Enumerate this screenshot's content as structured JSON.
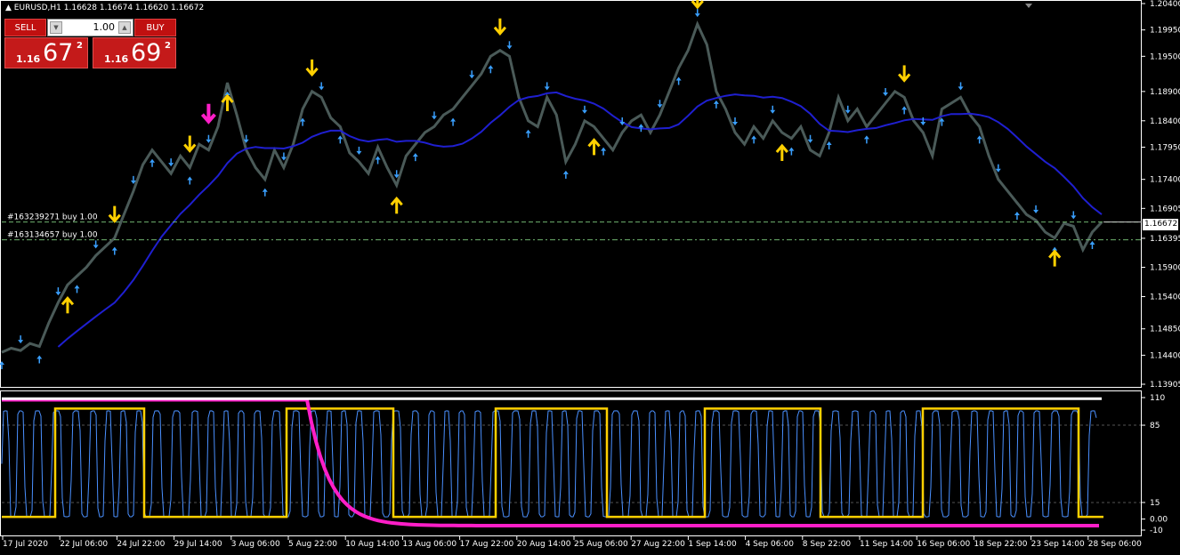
{
  "symbol_info": "EURUSD,H1  1.16628 1.16674 1.16620 1.16672",
  "trade_panel": {
    "sell_label": "SELL",
    "buy_label": "BUY",
    "lot": "1.00",
    "sell_prefix": "1.16",
    "sell_big": "67",
    "sell_sup": "2",
    "buy_prefix": "1.16",
    "buy_big": "69",
    "buy_sup": "2"
  },
  "current_price": "1.16672",
  "orders": [
    {
      "label": "#163239271 buy 1.00",
      "price": 1.16672
    },
    {
      "label": "#163134657 buy 1.00",
      "price": 1.1637
    }
  ],
  "colors": {
    "price_line": "#4a5a58",
    "ma": "#1f1fd0",
    "arrow_small": "#3aa0ff",
    "arrow_big": "#ffd000",
    "arrow_magenta": "#ff1ec8",
    "stoch_fast": "#4a90ff",
    "stoch_slow": "#ffd000",
    "order_line": "#6fb26f"
  },
  "chart_data": [
    {
      "type": "line",
      "y_ticks": [
        "1.20400",
        "1.19950",
        "1.19500",
        "1.18900",
        "1.18400",
        "1.17950",
        "1.17400",
        "1.16905",
        "1.16395",
        "1.15900",
        "1.15400",
        "1.14850",
        "1.14400",
        "1.13905"
      ],
      "ylim": [
        1.13905,
        1.204
      ],
      "x_ticks": [
        "17 Jul 2020",
        "22 Jul 06:00",
        "24 Jul 22:00",
        "29 Jul 14:00",
        "3 Aug 06:00",
        "5 Aug 22:00",
        "10 Aug 14:00",
        "13 Aug 06:00",
        "17 Aug 22:00",
        "20 Aug 14:00",
        "25 Aug 06:00",
        "27 Aug 22:00",
        "1 Sep 14:00",
        "4 Sep 06:00",
        "8 Sep 22:00",
        "11 Sep 14:00",
        "16 Sep 06:00",
        "18 Sep 22:00",
        "23 Sep 14:00",
        "28 Sep 06:00"
      ],
      "series": [
        {
          "values": [
            1.1445,
            1.1452,
            1.1448,
            1.146,
            1.1455,
            1.1495,
            1.153,
            1.156,
            1.1575,
            1.159,
            1.161,
            1.1625,
            1.164,
            1.168,
            1.172,
            1.1765,
            1.179,
            1.177,
            1.175,
            1.178,
            1.176,
            1.18,
            1.179,
            1.183,
            1.1905,
            1.185,
            1.179,
            1.176,
            1.174,
            1.179,
            1.176,
            1.18,
            1.186,
            1.189,
            1.188,
            1.1845,
            1.183,
            1.1785,
            1.177,
            1.175,
            1.1795,
            1.176,
            1.173,
            1.178,
            1.18,
            1.182,
            1.183,
            1.185,
            1.186,
            1.188,
            1.19,
            1.192,
            1.195,
            1.196,
            1.195,
            1.188,
            1.184,
            1.183,
            1.188,
            1.185,
            1.177,
            1.18,
            1.184,
            1.183,
            1.181,
            1.179,
            1.182,
            1.184,
            1.185,
            1.182,
            1.185,
            1.189,
            1.193,
            1.196,
            1.2005,
            1.197,
            1.189,
            1.186,
            1.182,
            1.18,
            1.183,
            1.181,
            1.184,
            1.182,
            1.181,
            1.183,
            1.179,
            1.178,
            1.182,
            1.188,
            1.184,
            1.186,
            1.183,
            1.185,
            1.187,
            1.189,
            1.188,
            1.184,
            1.182,
            1.178,
            1.186,
            1.187,
            1.188,
            1.185,
            1.183,
            1.178,
            1.174,
            1.172,
            1.17,
            1.168,
            1.167,
            1.165,
            1.164,
            1.1665,
            1.166,
            1.162,
            1.165,
            1.1667
          ]
        }
      ]
    },
    {
      "type": "line",
      "y_ticks": [
        "110",
        "85",
        "15",
        "0.00",
        "-10"
      ],
      "ylim": [
        -10,
        110
      ]
    }
  ]
}
